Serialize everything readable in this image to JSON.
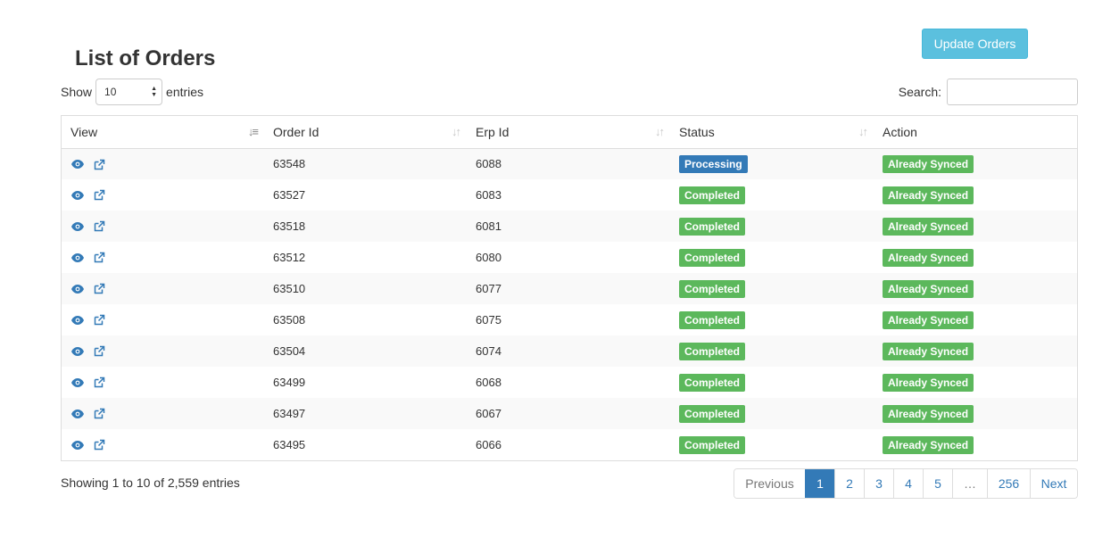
{
  "header": {
    "title": "List of Orders",
    "update_button": "Update Orders"
  },
  "length": {
    "show_label": "Show",
    "selected": "10",
    "entries_label": "entries"
  },
  "search": {
    "label": "Search:",
    "value": "",
    "placeholder": ""
  },
  "table": {
    "columns": [
      "View",
      "Order Id",
      "Erp Id",
      "Status",
      "Action"
    ],
    "rows": [
      {
        "order_id": "63548",
        "erp_id": "6088",
        "status": "Processing",
        "action": "Already Synced"
      },
      {
        "order_id": "63527",
        "erp_id": "6083",
        "status": "Completed",
        "action": "Already Synced"
      },
      {
        "order_id": "63518",
        "erp_id": "6081",
        "status": "Completed",
        "action": "Already Synced"
      },
      {
        "order_id": "63512",
        "erp_id": "6080",
        "status": "Completed",
        "action": "Already Synced"
      },
      {
        "order_id": "63510",
        "erp_id": "6077",
        "status": "Completed",
        "action": "Already Synced"
      },
      {
        "order_id": "63508",
        "erp_id": "6075",
        "status": "Completed",
        "action": "Already Synced"
      },
      {
        "order_id": "63504",
        "erp_id": "6074",
        "status": "Completed",
        "action": "Already Synced"
      },
      {
        "order_id": "63499",
        "erp_id": "6068",
        "status": "Completed",
        "action": "Already Synced"
      },
      {
        "order_id": "63497",
        "erp_id": "6067",
        "status": "Completed",
        "action": "Already Synced"
      },
      {
        "order_id": "63495",
        "erp_id": "6066",
        "status": "Completed",
        "action": "Already Synced"
      }
    ]
  },
  "footer": {
    "info": "Showing 1 to 10 of 2,559 entries"
  },
  "pagination": {
    "previous": "Previous",
    "pages": [
      "1",
      "2",
      "3",
      "4",
      "5",
      "…",
      "256"
    ],
    "next": "Next",
    "active": "1"
  },
  "colors": {
    "accent": "#337ab7",
    "info_button": "#5bc0de",
    "success": "#5cb85c"
  },
  "icons": {
    "view": "eye-icon",
    "open": "external-link-icon",
    "sort": "sort-icon"
  }
}
